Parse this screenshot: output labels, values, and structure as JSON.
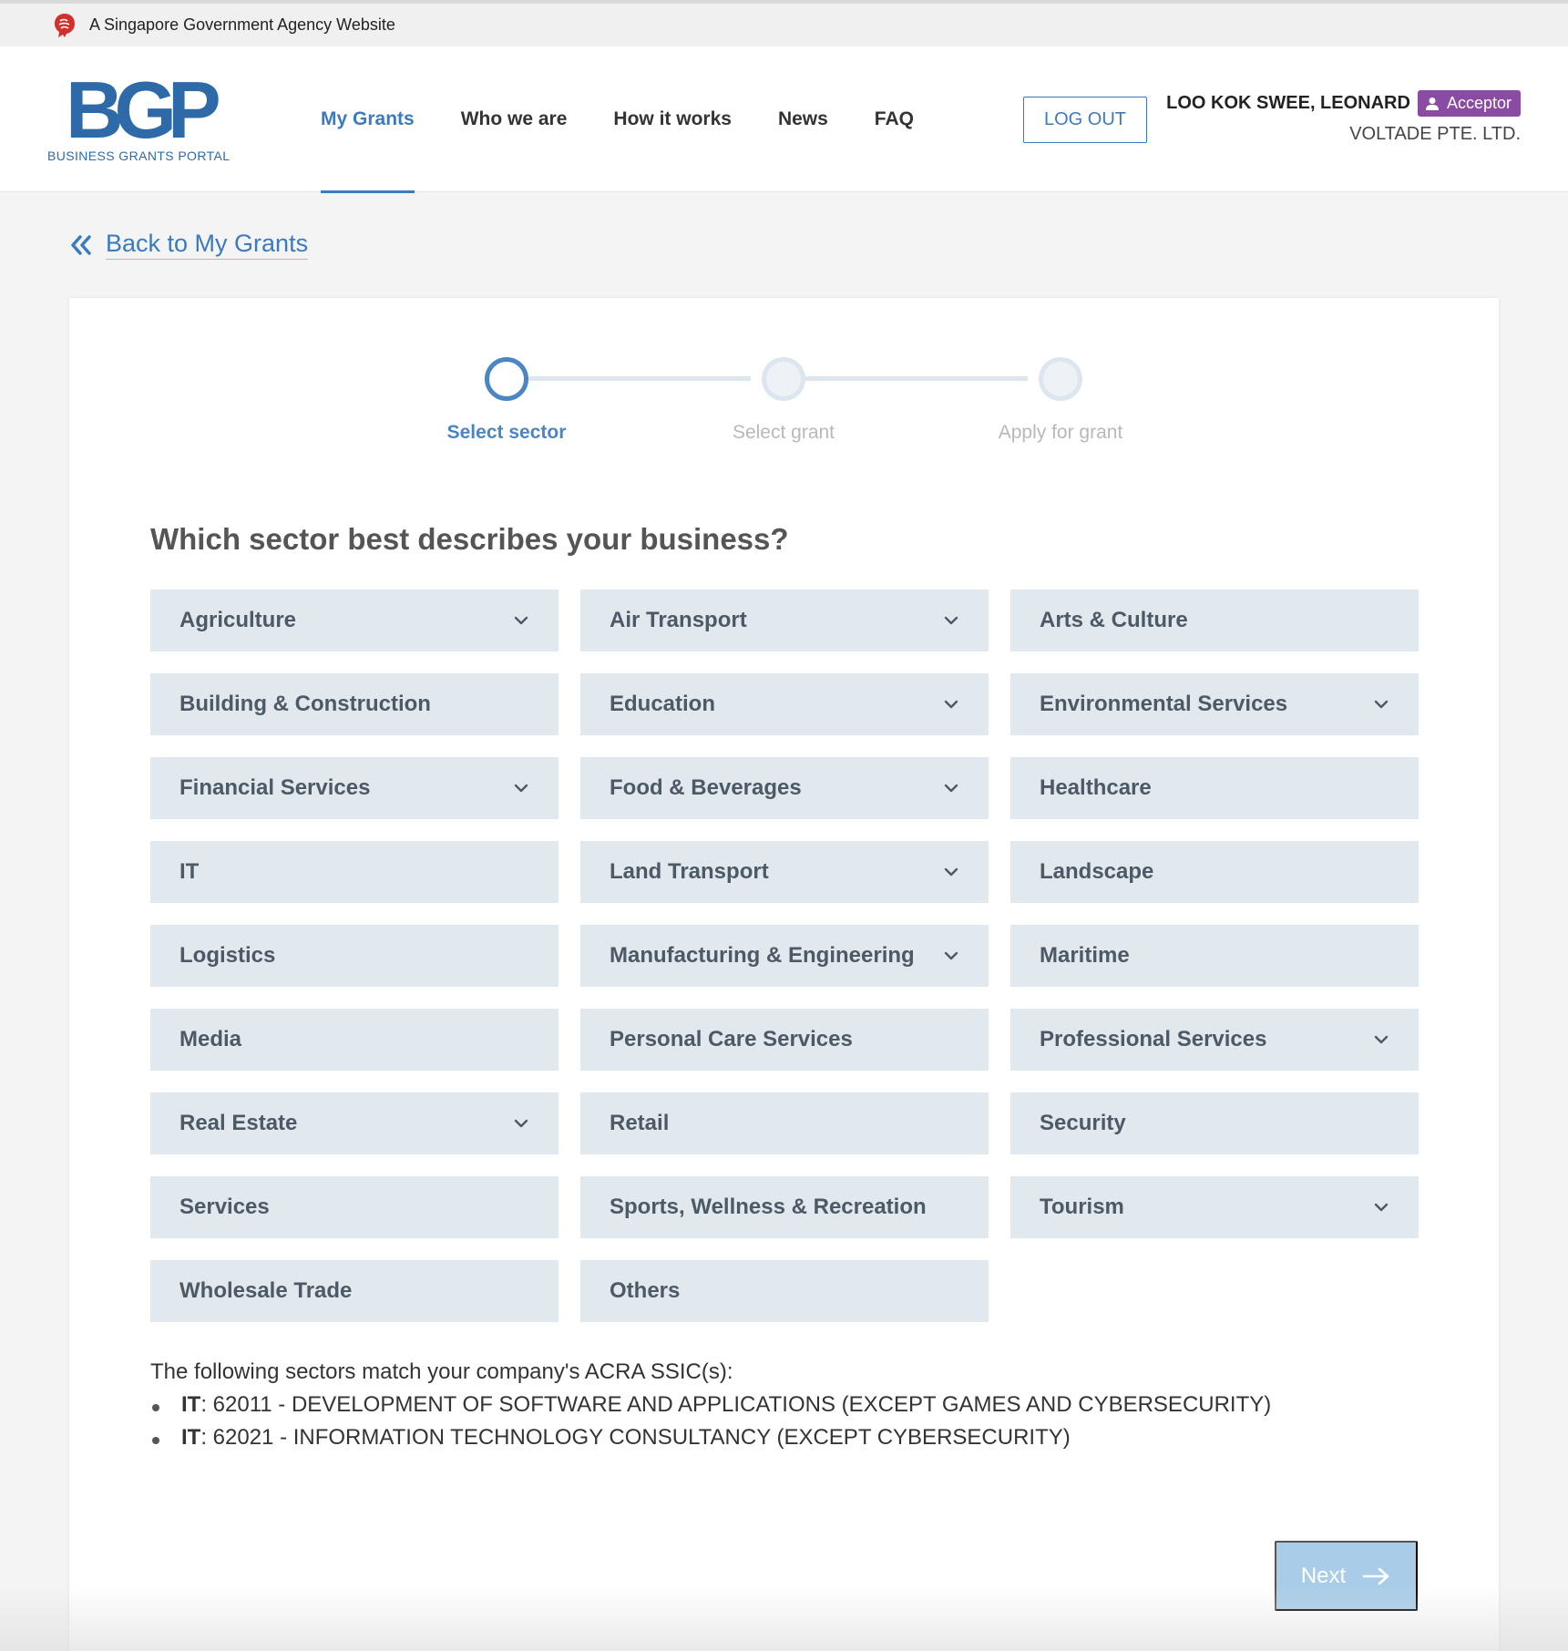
{
  "gov_banner": {
    "text": "A Singapore Government Agency Website",
    "icon": "lion-head-icon"
  },
  "logo": {
    "mark": "BGP",
    "subtitle": "BUSINESS GRANTS PORTAL"
  },
  "nav": {
    "items": [
      {
        "label": "My Grants",
        "active": true
      },
      {
        "label": "Who we are",
        "active": false
      },
      {
        "label": "How it works",
        "active": false
      },
      {
        "label": "News",
        "active": false
      },
      {
        "label": "FAQ",
        "active": false
      }
    ]
  },
  "header": {
    "logout_label": "LOG OUT"
  },
  "user": {
    "name": "LOO KOK SWEE, LEONARD",
    "role": "Acceptor",
    "company": "VOLTADE PTE. LTD."
  },
  "back": {
    "label": "Back to My Grants"
  },
  "stepper": {
    "steps": [
      {
        "label": "Select sector",
        "state": "active"
      },
      {
        "label": "Select grant",
        "state": "inactive"
      },
      {
        "label": "Apply for grant",
        "state": "inactive"
      }
    ]
  },
  "question": "Which sector best describes your business?",
  "sectors": [
    {
      "label": "Agriculture",
      "expandable": true
    },
    {
      "label": "Air Transport",
      "expandable": true
    },
    {
      "label": "Arts & Culture",
      "expandable": false
    },
    {
      "label": "Building & Construction",
      "expandable": false
    },
    {
      "label": "Education",
      "expandable": true
    },
    {
      "label": "Environmental Services",
      "expandable": true
    },
    {
      "label": "Financial Services",
      "expandable": true
    },
    {
      "label": "Food & Beverages",
      "expandable": true
    },
    {
      "label": "Healthcare",
      "expandable": false
    },
    {
      "label": "IT",
      "expandable": false
    },
    {
      "label": "Land Transport",
      "expandable": true
    },
    {
      "label": "Landscape",
      "expandable": false
    },
    {
      "label": "Logistics",
      "expandable": false
    },
    {
      "label": "Manufacturing & Engineering",
      "expandable": true
    },
    {
      "label": "Maritime",
      "expandable": false
    },
    {
      "label": "Media",
      "expandable": false
    },
    {
      "label": "Personal Care Services",
      "expandable": false
    },
    {
      "label": "Professional Services",
      "expandable": true
    },
    {
      "label": "Real Estate",
      "expandable": true
    },
    {
      "label": "Retail",
      "expandable": false
    },
    {
      "label": "Security",
      "expandable": false
    },
    {
      "label": "Services",
      "expandable": false
    },
    {
      "label": "Sports, Wellness & Recreation",
      "expandable": false
    },
    {
      "label": "Tourism",
      "expandable": true
    },
    {
      "label": "Wholesale Trade",
      "expandable": false
    },
    {
      "label": "Others",
      "expandable": false
    }
  ],
  "ssic": {
    "intro": "The following sectors match your company's ACRA SSIC(s):",
    "items": [
      {
        "sector": "IT",
        "text": ": 62011 - DEVELOPMENT OF SOFTWARE AND APPLICATIONS (EXCEPT GAMES AND CYBERSECURITY)"
      },
      {
        "sector": "IT",
        "text": ": 62021 - INFORMATION TECHNOLOGY CONSULTANCY (EXCEPT CYBERSECURITY)"
      }
    ]
  },
  "next": {
    "label": "Next"
  },
  "colors": {
    "accent": "#3a7abf",
    "badge": "#8a4ca3",
    "sector_bg": "#e1e8ee",
    "next_disabled": "#a9cde8"
  }
}
